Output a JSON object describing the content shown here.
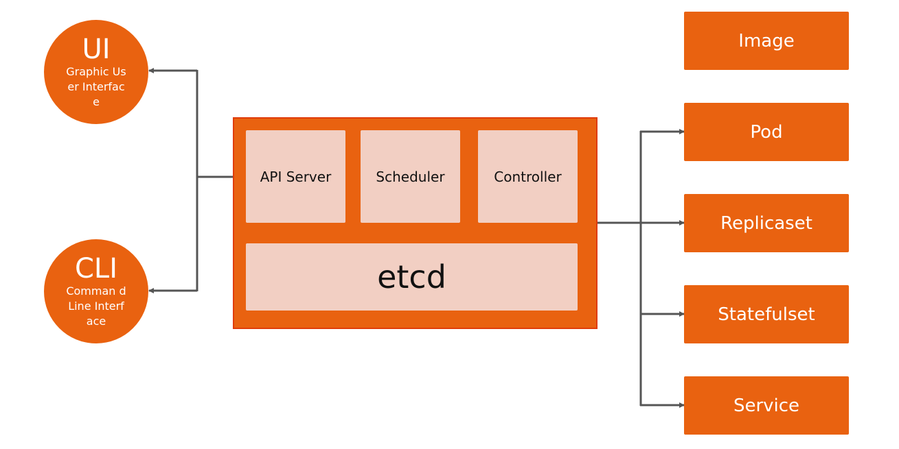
{
  "clients": [
    {
      "title": "UI",
      "subtitle": "Graphic User Interface"
    },
    {
      "title": "CLI",
      "subtitle": "Comman d Line Interface"
    }
  ],
  "control_plane": {
    "components": [
      "API Server",
      "Scheduler",
      "Controller"
    ],
    "store": "etcd"
  },
  "resources": [
    "Image",
    "Pod",
    "Replicaset",
    "Statefulset",
    "Service"
  ],
  "colors": {
    "orange": "#e96210",
    "border": "#e03c0a",
    "light": "#f2cfc3",
    "line": "#555555"
  }
}
